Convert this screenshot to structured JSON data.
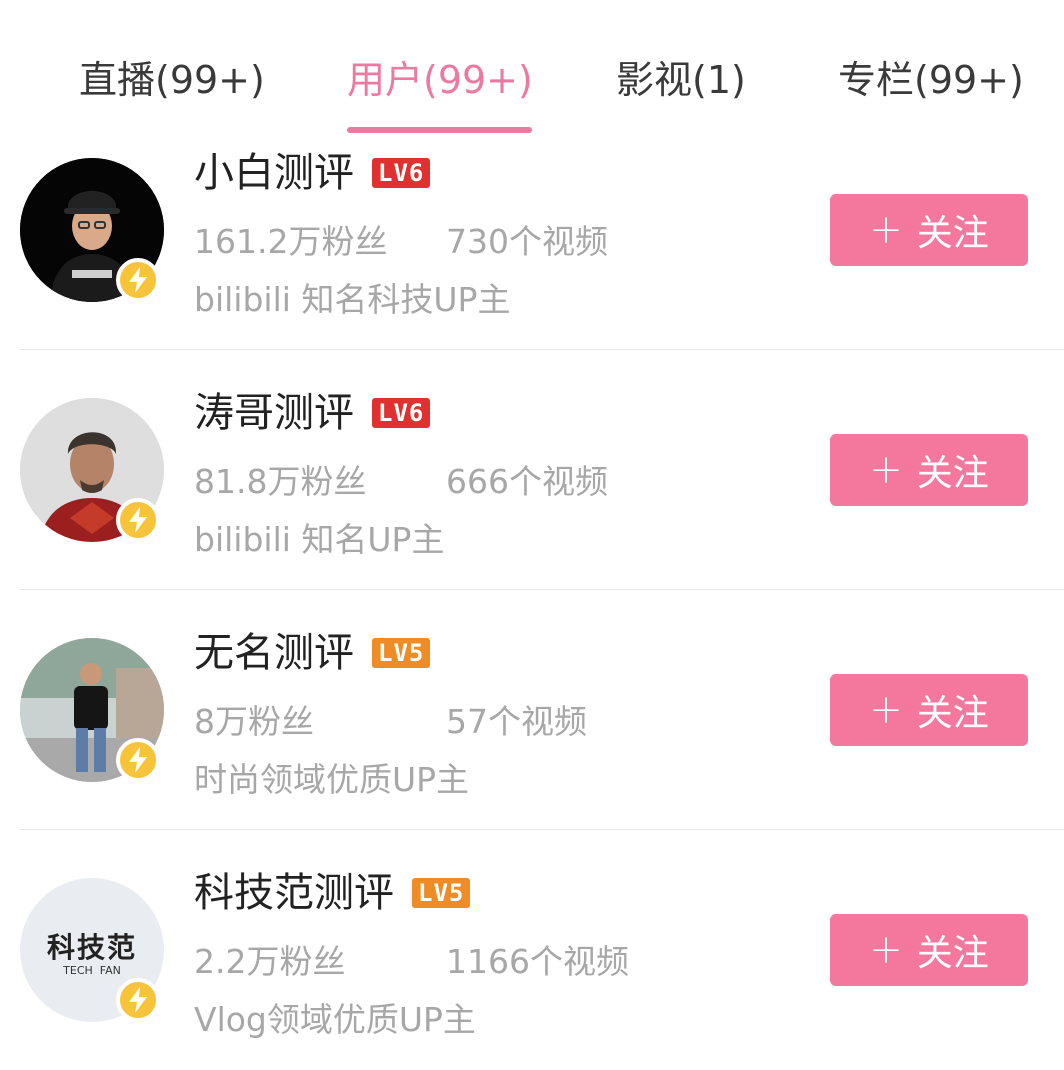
{
  "tabs": [
    {
      "label": "直播(99+)"
    },
    {
      "label": "用户(99+)"
    },
    {
      "label": "影视(1)"
    },
    {
      "label": "专栏(99+)"
    }
  ],
  "users": [
    {
      "name": "小白测评",
      "level": "LV6",
      "level_color": "#e03131",
      "fans": "161.2万粉丝",
      "videos": "730个视频",
      "desc": "bilibili 知名科技UP主",
      "follow_label": "关注"
    },
    {
      "name": "涛哥测评",
      "level": "LV6",
      "level_color": "#e03131",
      "fans": "81.8万粉丝",
      "videos": "666个视频",
      "desc": "bilibili 知名UP主",
      "follow_label": "关注"
    },
    {
      "name": "无名测评",
      "level": "LV5",
      "level_color": "#f08c25",
      "fans": "8万粉丝",
      "videos": "57个视频",
      "desc": "时尚领域优质UP主",
      "follow_label": "关注"
    },
    {
      "name": "科技范测评",
      "level": "LV5",
      "level_color": "#f08c25",
      "fans": "2.2万粉丝",
      "videos": "1166个视频",
      "desc": "Vlog领域优质UP主",
      "follow_label": "关注",
      "avatar_text": "科技范",
      "avatar_subtext": "TECH  FAN"
    }
  ],
  "colors": {
    "accent": "#ec7aa0",
    "follow_button": "#f4789e",
    "verified_badge": "#f7c33a"
  },
  "icons": {
    "plus": "plus-icon",
    "verified": "lightning-icon"
  }
}
